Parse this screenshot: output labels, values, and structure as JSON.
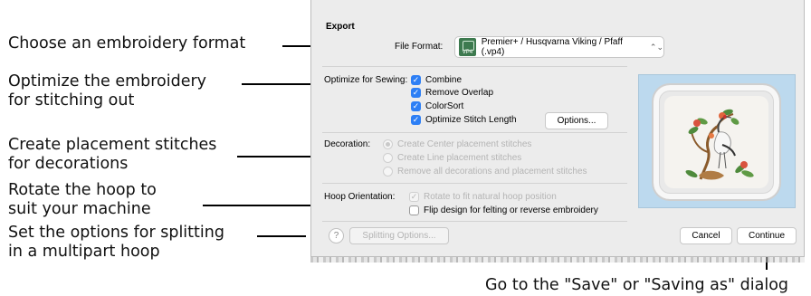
{
  "callouts": {
    "format": "Choose an embroidery format",
    "optimize_1": "Optimize the embroidery",
    "optimize_2": "for stitching out",
    "placement_1": "Create placement stitches",
    "placement_2": "for decorations",
    "rotate_1": "Rotate the hoop to",
    "rotate_2": "suit your machine",
    "split_1": "Set the options for splitting",
    "split_2": "in a multipart hoop",
    "continue": "Go to the \"Save\" or \"Saving as\" dialog"
  },
  "dialog": {
    "title": "Export",
    "file_format": {
      "label": "File Format:",
      "selected": "Premier+ / Husqvarna Viking / Pfaff (.vp4)",
      "icon_text": "VP4",
      "icon": "vp4-file-icon",
      "chevron": "⌃⌄"
    },
    "optimize": {
      "label": "Optimize for Sewing:",
      "items": [
        {
          "label": "Combine",
          "checked": true
        },
        {
          "label": "Remove Overlap",
          "checked": true
        },
        {
          "label": "ColorSort",
          "checked": true
        },
        {
          "label": "Optimize Stitch Length",
          "checked": true
        }
      ],
      "options_button": "Options..."
    },
    "decoration": {
      "label": "Decoration:",
      "options": [
        {
          "label": "Create Center placement stitches",
          "selected": true,
          "enabled": false
        },
        {
          "label": "Create Line placement stitches",
          "selected": false,
          "enabled": false
        },
        {
          "label": "Remove all decorations and placement stitches",
          "selected": false,
          "enabled": false
        }
      ]
    },
    "hoop": {
      "label": "Hoop Orientation:",
      "rotate": {
        "label": "Rotate to fit natural hoop position",
        "checked": true,
        "enabled": false
      },
      "flip": {
        "label": "Flip design for felting or reverse embroidery",
        "checked": false,
        "enabled": true
      }
    },
    "help_button": "?",
    "splitting_button": "Splitting Options...",
    "cancel_button": "Cancel",
    "continue_button": "Continue",
    "preview": {
      "icon": "embroidery-preview-crane-flowers"
    }
  },
  "colors": {
    "accent": "#2d7ff5",
    "dialog_bg": "#ececec",
    "preview_bg": "#bcd9ee",
    "icon_green": "#3d7a4f"
  }
}
